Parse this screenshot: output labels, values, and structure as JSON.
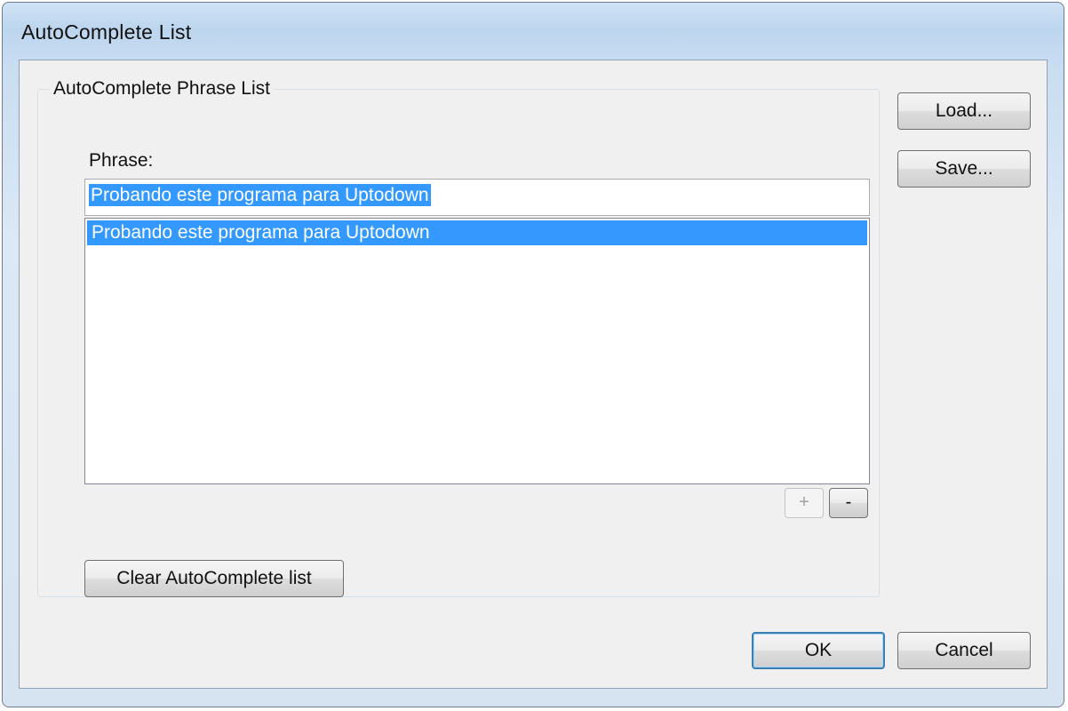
{
  "window": {
    "title": "AutoComplete List"
  },
  "group": {
    "legend": "AutoComplete Phrase List",
    "phrase_label": "Phrase:",
    "phrase_value": "Probando este programa para Uptodown",
    "list_items": [
      "Probando este programa para Uptodown"
    ],
    "add_label": "+",
    "remove_label": "-",
    "clear_label": "Clear AutoComplete list"
  },
  "side_buttons": {
    "load_label": "Load...",
    "save_label": "Save..."
  },
  "footer": {
    "ok_label": "OK",
    "cancel_label": "Cancel"
  },
  "colors": {
    "selection": "#3399ff",
    "title_bar": "#bcd5ee",
    "client": "#f0f0f0"
  }
}
